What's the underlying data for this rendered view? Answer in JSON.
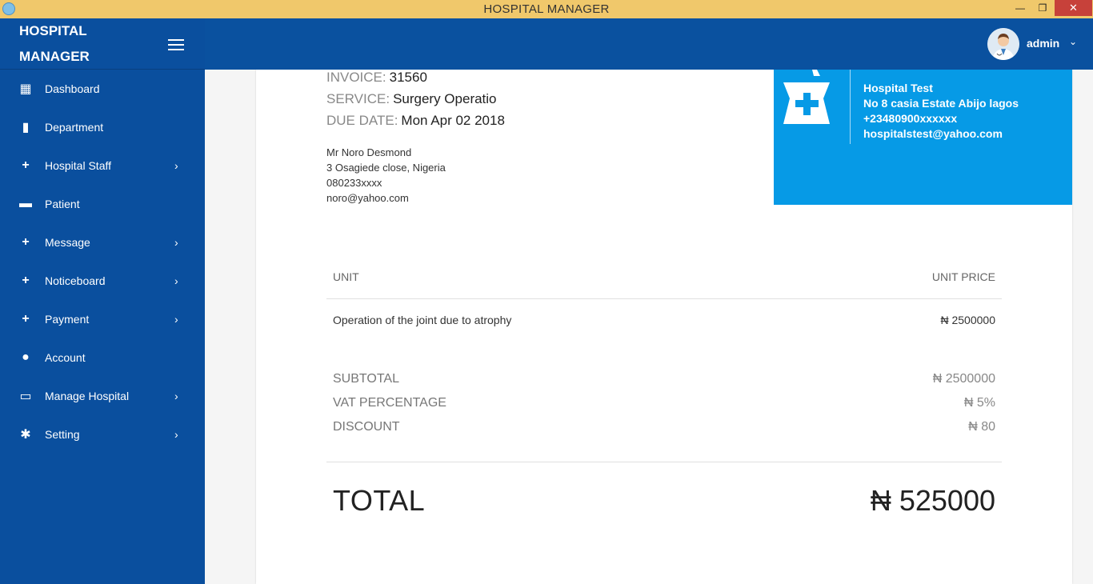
{
  "window": {
    "title": "HOSPITAL MANAGER",
    "min_glyph": "—",
    "max_glyph": "❐",
    "close_glyph": "✕"
  },
  "brand": {
    "line1": "HOSPITAL",
    "line2": "MANAGER"
  },
  "nav": {
    "items": [
      {
        "label": "Dashboard",
        "icon": "dashboard-icon",
        "glyph": "▦",
        "chevron": ""
      },
      {
        "label": "Department",
        "icon": "book-icon",
        "glyph": "▮",
        "chevron": ""
      },
      {
        "label": "Hospital Staff",
        "icon": "plus-icon",
        "glyph": "+",
        "chevron": "›"
      },
      {
        "label": "Patient",
        "icon": "bed-icon",
        "glyph": "▬",
        "chevron": ""
      },
      {
        "label": "Message",
        "icon": "plus-icon",
        "glyph": "+",
        "chevron": "›"
      },
      {
        "label": "Noticeboard",
        "icon": "plus-icon",
        "glyph": "+",
        "chevron": "›"
      },
      {
        "label": "Payment",
        "icon": "plus-icon",
        "glyph": "+",
        "chevron": "›"
      },
      {
        "label": "Account",
        "icon": "account-icon",
        "glyph": "●",
        "chevron": ""
      },
      {
        "label": "Manage Hospital",
        "icon": "monitor-icon",
        "glyph": "▭",
        "chevron": "›"
      },
      {
        "label": "Setting",
        "icon": "gear-icon",
        "glyph": "✱",
        "chevron": "›"
      }
    ]
  },
  "header": {
    "user": "admin",
    "caret": "⌄"
  },
  "invoice": {
    "invoice_label": "INVOICE:",
    "invoice_value": "31560",
    "service_label": "SERVICE:",
    "service_value": "Surgery Operatio",
    "due_label": "DUE DATE:",
    "due_value": "Mon Apr 02 2018",
    "client": {
      "name": "Mr Noro Desmond",
      "address": "3 Osagiede close, Nigeria",
      "phone": "080233xxxx",
      "email": "noro@yahoo.com"
    },
    "hospital": {
      "name": "Hospital Test",
      "address": "No 8 casia Estate Abijo lagos",
      "phone": "+23480900xxxxxx",
      "email": "hospitalstest@yahoo.com"
    },
    "table": {
      "col_unit": "UNIT",
      "col_price": "UNIT PRICE",
      "rows": [
        {
          "description": "Operation of the joint due to atrophy",
          "price": "₦ 2500000"
        }
      ]
    },
    "summary": {
      "subtotal_label": "SUBTOTAL",
      "subtotal_value": "₦ 2500000",
      "vat_label": "VAT PERCENTAGE",
      "vat_value": "₦ 5%",
      "discount_label": "DISCOUNT",
      "discount_value": "₦ 80"
    },
    "total_label": "TOTAL",
    "total_value": "₦ 525000"
  },
  "colors": {
    "sidebar": "#0a4f9e",
    "header": "#0a519f",
    "hospital_box": "#069ae6",
    "titlebar": "#f0c86b",
    "close_button": "#c7413a"
  }
}
